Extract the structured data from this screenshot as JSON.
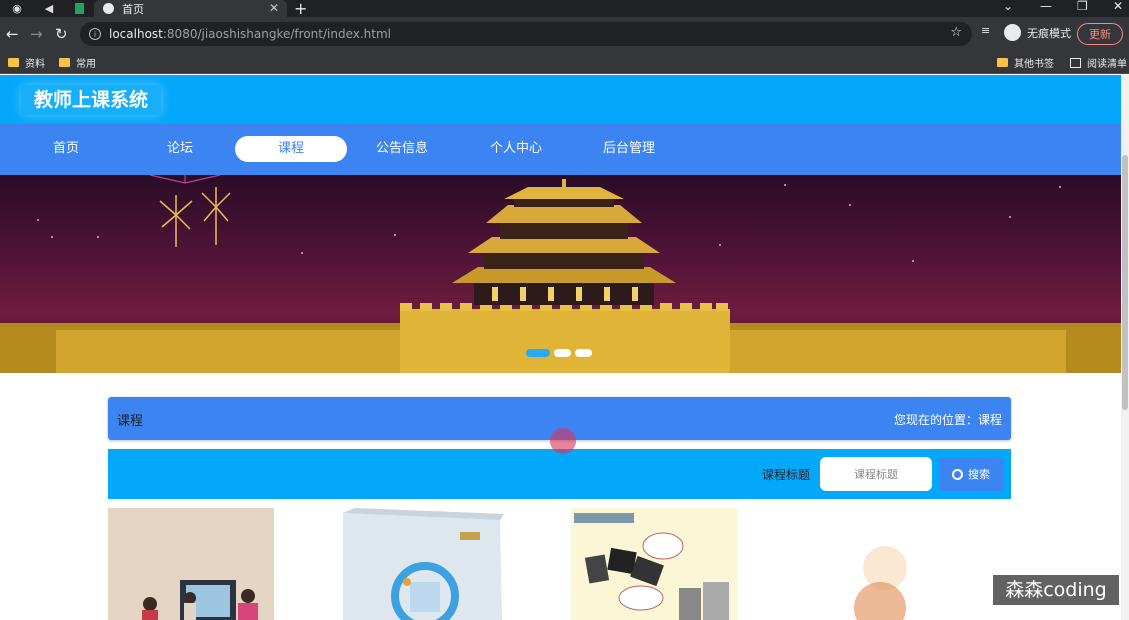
{
  "browser": {
    "tab_title": "首页",
    "new_tab_symbol": "+",
    "tab_close_symbol": "✕",
    "url_host": "localhost",
    "url_path": ":8080/jiaoshishangke/front/index.html",
    "profile_label": "无痕模式",
    "update_button": "更新",
    "bookmarks": [
      "资料",
      "常用"
    ],
    "other_bookmarks": "其他书签",
    "reading_list": "阅读清单"
  },
  "site": {
    "title": "教师上课系统",
    "nav": [
      {
        "label": "首页",
        "active": false
      },
      {
        "label": "论坛",
        "active": false
      },
      {
        "label": "课程",
        "active": true
      },
      {
        "label": "公告信息",
        "active": false
      },
      {
        "label": "个人中心",
        "active": false
      },
      {
        "label": "后台管理",
        "active": false
      }
    ]
  },
  "banner": {
    "slide_count": 3,
    "active_slide": 1
  },
  "section": {
    "title": "课程",
    "location_label": "您现在的位置：",
    "location_value": "课程"
  },
  "search": {
    "label": "课程标题",
    "placeholder": "课程标题",
    "button": "搜索"
  },
  "watermark": "森森coding",
  "colors": {
    "header": "#04a8fa",
    "nav": "#3b84f2",
    "banner": "#551439"
  }
}
